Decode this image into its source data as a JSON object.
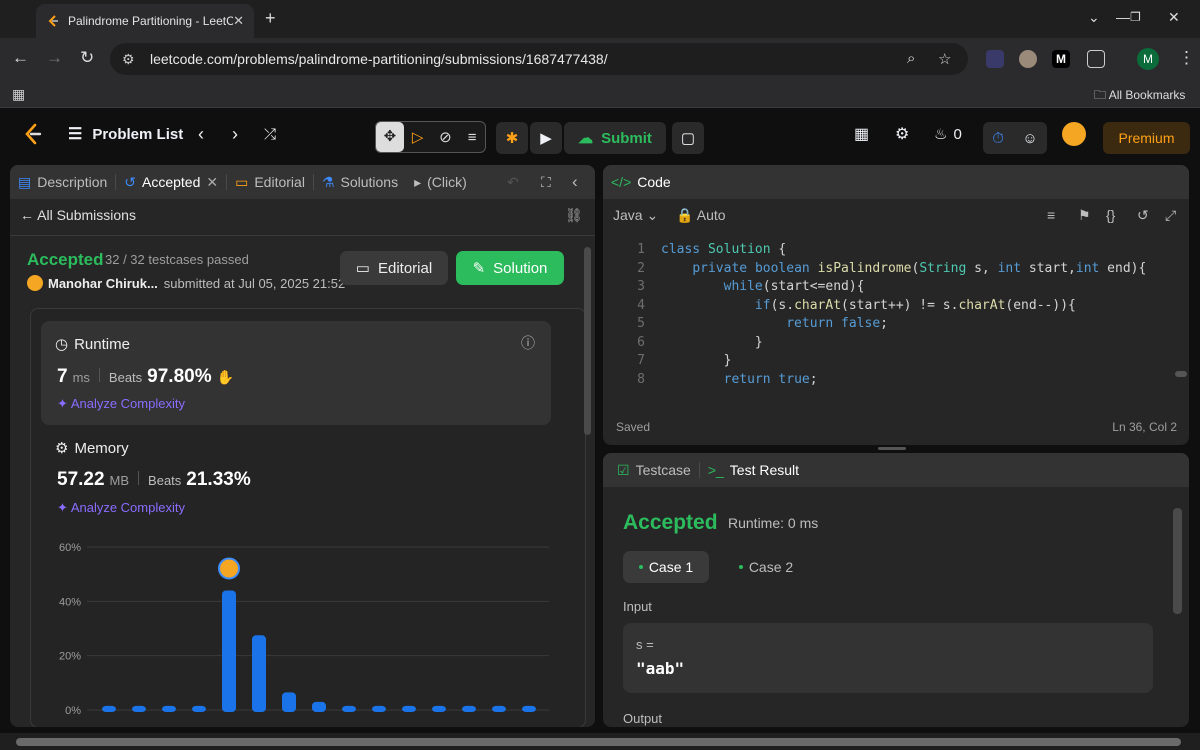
{
  "browser": {
    "tab_title": "Palindrome Partitioning - LeetC",
    "url": "leetcode.com/problems/palindrome-partitioning/submissions/1687477438/",
    "all_bookmarks": "All Bookmarks",
    "profile_initial": "M"
  },
  "nav": {
    "problem_list": "Problem List",
    "submit": "Submit",
    "streak": "0",
    "premium": "Premium"
  },
  "left_panel": {
    "tabs": [
      "Description",
      "Accepted",
      "Editorial",
      "Solutions",
      "(Click)"
    ],
    "all_submissions": "All Submissions",
    "status": "Accepted",
    "testcases": "32 / 32 testcases passed",
    "author": "Manohar Chiruk...",
    "submitted_at": "submitted at Jul 05, 2025 21:52",
    "editorial_btn": "Editorial",
    "solution_btn": "Solution",
    "runtime": {
      "label": "Runtime",
      "value": "7",
      "unit": "ms",
      "beats_label": "Beats",
      "beats": "97.80%",
      "analyze": "Analyze Complexity"
    },
    "memory": {
      "label": "Memory",
      "value": "57.22",
      "unit": "MB",
      "beats_label": "Beats",
      "beats": "21.33%",
      "analyze": "Analyze Complexity"
    }
  },
  "chart_data": {
    "type": "bar",
    "yticks": [
      "60%",
      "40%",
      "20%",
      "0%"
    ],
    "ylim": [
      0,
      60
    ],
    "values": [
      1.5,
      1.5,
      1.5,
      1.5,
      44,
      27.5,
      6.5,
      3,
      1.5,
      1.5,
      1.5,
      1.5,
      1.5,
      1.5,
      1.5
    ],
    "highlight_index": 4,
    "bar_color": "#1a73e8"
  },
  "code_panel": {
    "title": "Code",
    "language": "Java",
    "mode": "Auto",
    "lines": [
      {
        "n": "1",
        "t": "class Solution {"
      },
      {
        "n": "2",
        "t": "    private boolean isPalindrome(String s, int start,int end){"
      },
      {
        "n": "3",
        "t": "        while(start<=end){"
      },
      {
        "n": "4",
        "t": "            if(s.charAt(start++) != s.charAt(end--)){"
      },
      {
        "n": "5",
        "t": "                return false;"
      },
      {
        "n": "6",
        "t": "            }"
      },
      {
        "n": "7",
        "t": "        }"
      },
      {
        "n": "8",
        "t": "        return true;"
      }
    ],
    "saved": "Saved",
    "cursor": "Ln 36, Col 2"
  },
  "test_panel": {
    "tabs": [
      "Testcase",
      "Test Result"
    ],
    "status": "Accepted",
    "runtime": "Runtime: 0 ms",
    "cases": [
      "Case 1",
      "Case 2"
    ],
    "input_label": "Input",
    "input_name": "s =",
    "input_value": "\"aab\"",
    "output_label": "Output"
  }
}
